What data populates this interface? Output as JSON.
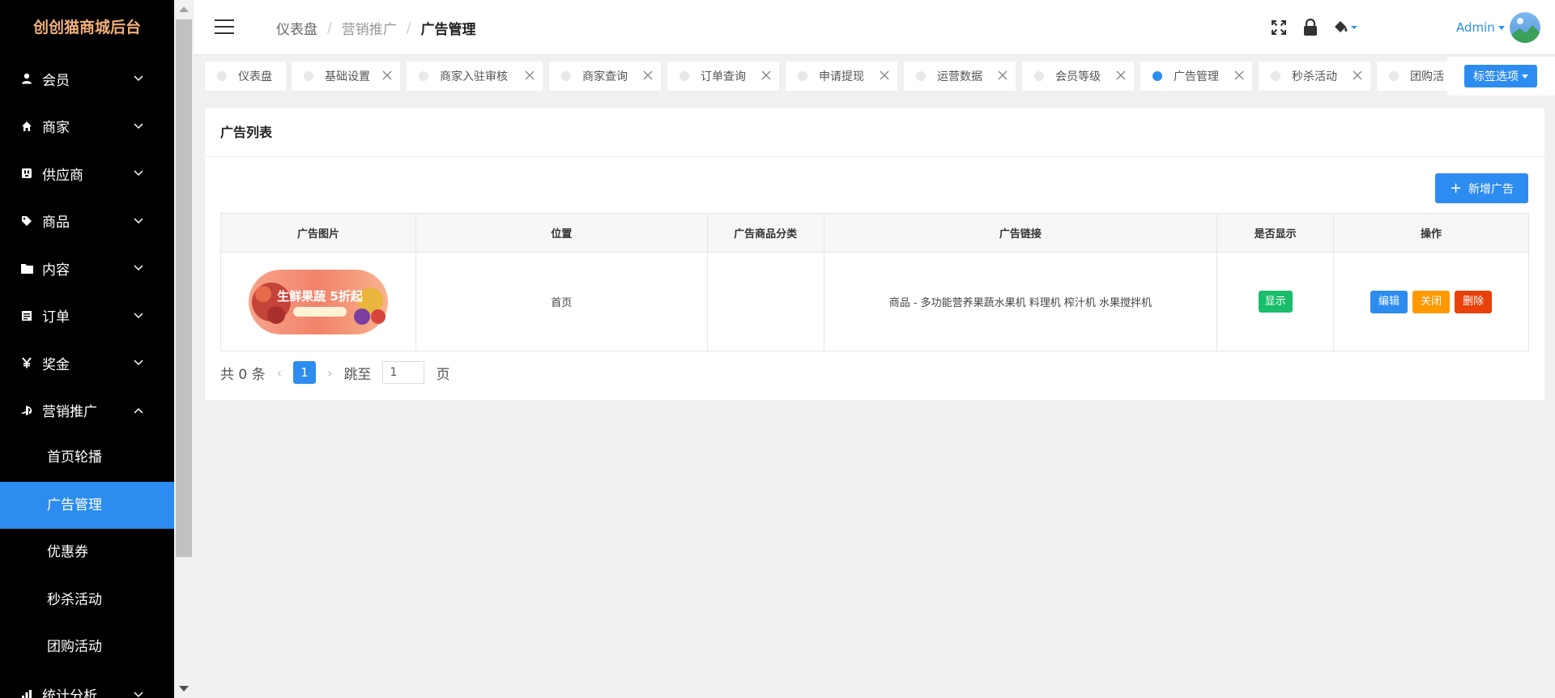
{
  "app": {
    "brand": "创创猫商城后台"
  },
  "sidebar": {
    "items": [
      {
        "label": "会员",
        "icon": "user-icon"
      },
      {
        "label": "商家",
        "icon": "home-icon"
      },
      {
        "label": "供应商",
        "icon": "plug-icon"
      },
      {
        "label": "商品",
        "icon": "tag-icon"
      },
      {
        "label": "内容",
        "icon": "folder-icon"
      },
      {
        "label": "订单",
        "icon": "list-icon"
      },
      {
        "label": "奖金",
        "icon": "yen-icon"
      },
      {
        "label": "营销推广",
        "icon": "gamepad-icon",
        "expanded": true
      },
      {
        "label": "统计分析",
        "icon": "chart-icon"
      }
    ],
    "submenu": [
      {
        "label": "首页轮播"
      },
      {
        "label": "广告管理",
        "active": true
      },
      {
        "label": "优惠券"
      },
      {
        "label": "秒杀活动"
      },
      {
        "label": "团购活动"
      }
    ]
  },
  "header": {
    "breadcrumb": [
      "仪表盘",
      "营销推广",
      "广告管理"
    ],
    "user": "Admin"
  },
  "tabs": [
    {
      "label": "仪表盘",
      "closable": false
    },
    {
      "label": "基础设置",
      "closable": true
    },
    {
      "label": "商家入驻审核",
      "closable": true
    },
    {
      "label": "商家查询",
      "closable": true
    },
    {
      "label": "订单查询",
      "closable": true
    },
    {
      "label": "申请提现",
      "closable": true
    },
    {
      "label": "运营数据",
      "closable": true
    },
    {
      "label": "会员等级",
      "closable": true
    },
    {
      "label": "广告管理",
      "closable": true,
      "active": true
    },
    {
      "label": "秒杀活动",
      "closable": true
    },
    {
      "label": "团购活",
      "closable": true
    }
  ],
  "tab_options_label": "标签选项",
  "main": {
    "title": "广告列表",
    "add_label": "新增广告",
    "table": {
      "columns": [
        "广告图片",
        "位置",
        "广告商品分类",
        "广告链接",
        "是否显示",
        "操作"
      ],
      "rows": [
        {
          "banner_text": "生鲜果蔬 5折起",
          "position": "首页",
          "category": "",
          "link": "商品 - 多功能营养果蔬水果机 料理机 榨汁机 水果搅拌机",
          "display": "显示",
          "actions": {
            "edit": "编辑",
            "close": "关闭",
            "delete": "删除"
          }
        }
      ]
    },
    "pager": {
      "total_text": "共 0 条",
      "current_page": "1",
      "jump_prefix": "跳至",
      "jump_value": "1",
      "jump_suffix": "页"
    }
  },
  "colors": {
    "primary": "#2d8cf0",
    "success": "#19be6b",
    "warning": "#ff9900",
    "danger": "#e8410a",
    "brand": "#f0b07a"
  }
}
